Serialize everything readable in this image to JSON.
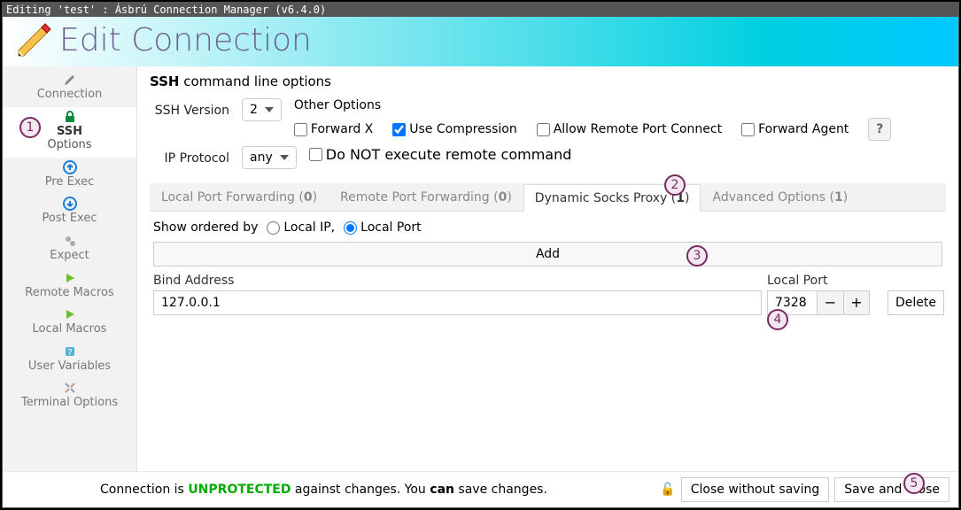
{
  "window": {
    "title": "Editing 'test' : Ásbrú Connection Manager (v6.4.0)"
  },
  "header": {
    "title": "Edit Connection"
  },
  "sidebar": [
    {
      "id": "connection",
      "label": "Connection"
    },
    {
      "id": "ssh-options",
      "label": "SSH",
      "sub": "Options",
      "active": true
    },
    {
      "id": "pre-exec",
      "label": "Pre Exec"
    },
    {
      "id": "post-exec",
      "label": "Post Exec"
    },
    {
      "id": "expect",
      "label": "Expect"
    },
    {
      "id": "remote-macros",
      "label": "Remote Macros"
    },
    {
      "id": "local-macros",
      "label": "Local Macros"
    },
    {
      "id": "user-variables",
      "label": "User Variables"
    },
    {
      "id": "terminal-options",
      "label": "Terminal Options"
    }
  ],
  "section": {
    "title_bold": "SSH",
    "title_rest": " command line options"
  },
  "ssh": {
    "version_label": "SSH Version",
    "version_value": "2",
    "ip_label": "IP Protocol",
    "ip_value": "any",
    "other_label": "Other Options",
    "forward_x": "Forward X",
    "use_compression": "Use Compression",
    "allow_remote_port": "Allow Remote Port Connect",
    "forward_agent": "Forward Agent",
    "no_remote_cmd": "Do NOT execute remote command"
  },
  "tabs": {
    "local_pf_pre": "Local Port Forwarding (",
    "local_pf_n": "0",
    "local_pf_post": ")",
    "remote_pf_pre": "Remote Port Forwarding (",
    "remote_pf_n": "0",
    "remote_pf_post": ")",
    "dyn_pre": "Dynamic Socks Proxy (",
    "dyn_n": "1",
    "dyn_post": ")",
    "adv_pre": "Advanced Options (",
    "adv_n": "1",
    "adv_post": ")"
  },
  "panel": {
    "order_label": "Show ordered by",
    "order_localip": "Local IP,",
    "order_localport": "Local Port",
    "add_btn": "Add",
    "col_bind": "Bind Address",
    "col_port": "Local Port",
    "row_bind": "127.0.0.1",
    "row_port": "7328",
    "delete_btn": "Delete"
  },
  "footer": {
    "text_pre": "Connection is ",
    "text_unprotected": "UNPROTECTED",
    "text_mid": " against changes. You ",
    "text_can": "can",
    "text_post": " save changes.",
    "close_no_save": "Close without saving",
    "save_close": "Save and Close"
  },
  "badges": {
    "1": "1",
    "2": "2",
    "3": "3",
    "4": "4",
    "5": "5"
  }
}
